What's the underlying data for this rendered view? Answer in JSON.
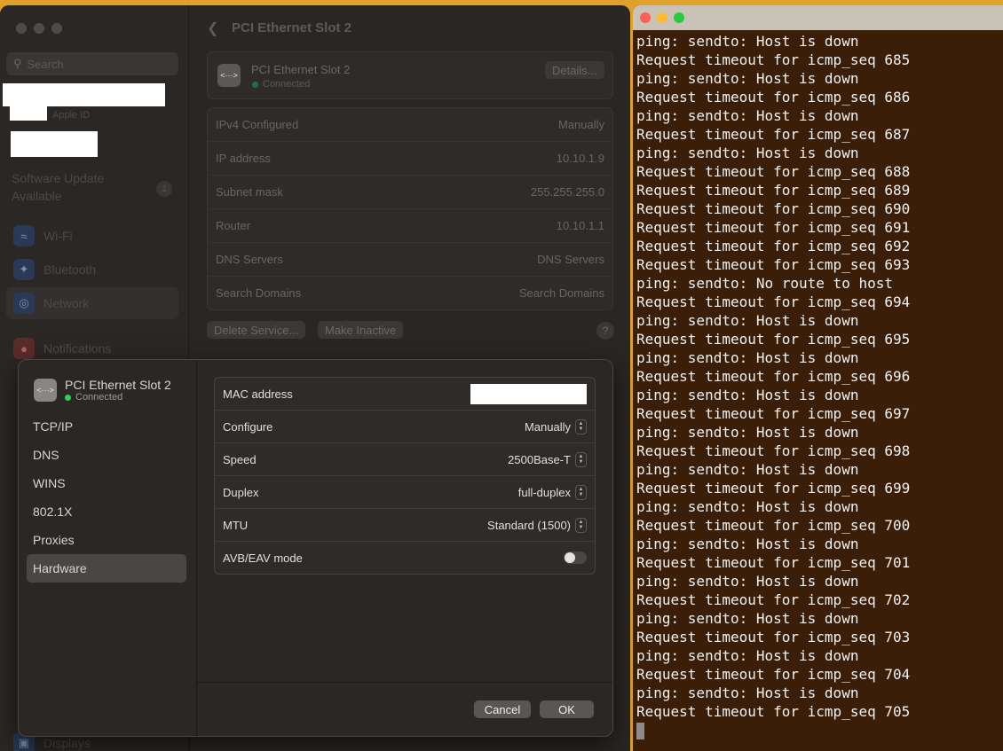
{
  "settings": {
    "search_placeholder": "Search",
    "apple_id_label": "Apple ID",
    "software_update_label": "Software Update Available",
    "software_update_badge": "1",
    "nav": [
      {
        "label": "Wi-Fi",
        "icon": "wifi-icon"
      },
      {
        "label": "Bluetooth",
        "icon": "bluetooth-icon"
      },
      {
        "label": "Network",
        "icon": "network-icon",
        "selected": true
      },
      {
        "label": "Notifications",
        "icon": "notifications-icon"
      },
      {
        "label": "Displays",
        "icon": "displays-icon"
      }
    ],
    "header_title": "PCI Ethernet Slot 2",
    "interface_name": "PCI Ethernet Slot 2",
    "interface_status": "Connected",
    "details_button": "Details...",
    "ipv4": {
      "configured_label": "IPv4 Configured",
      "configured_value": "Manually",
      "ip_label": "IP address",
      "ip_value": "10.10.1.9",
      "subnet_label": "Subnet mask",
      "subnet_value": "255.255.255.0",
      "router_label": "Router",
      "router_value": "10.10.1.1",
      "dns_label": "DNS Servers",
      "dns_value": "DNS Servers",
      "search_label": "Search Domains",
      "search_value": "Search Domains"
    },
    "delete_service_button": "Delete Service...",
    "make_inactive_button": "Make Inactive",
    "help_button": "?"
  },
  "sheet": {
    "interface_name": "PCI Ethernet Slot 2",
    "interface_status": "Connected",
    "tabs": [
      "TCP/IP",
      "DNS",
      "WINS",
      "802.1X",
      "Proxies",
      "Hardware"
    ],
    "selected_tab": "Hardware",
    "hardware": {
      "mac_label": "MAC address",
      "configure_label": "Configure",
      "configure_value": "Manually",
      "speed_label": "Speed",
      "speed_value": "2500Base-T",
      "duplex_label": "Duplex",
      "duplex_value": "full-duplex",
      "mtu_label": "MTU",
      "mtu_value": "Standard (1500)",
      "avb_label": "AVB/EAV mode",
      "avb_enabled": false
    },
    "cancel_button": "Cancel",
    "ok_button": "OK"
  },
  "terminal": {
    "lines": [
      "ping: sendto: Host is down",
      "Request timeout for icmp_seq 685",
      "ping: sendto: Host is down",
      "Request timeout for icmp_seq 686",
      "ping: sendto: Host is down",
      "Request timeout for icmp_seq 687",
      "ping: sendto: Host is down",
      "Request timeout for icmp_seq 688",
      "Request timeout for icmp_seq 689",
      "Request timeout for icmp_seq 690",
      "Request timeout for icmp_seq 691",
      "Request timeout for icmp_seq 692",
      "Request timeout for icmp_seq 693",
      "ping: sendto: No route to host",
      "Request timeout for icmp_seq 694",
      "ping: sendto: Host is down",
      "Request timeout for icmp_seq 695",
      "ping: sendto: Host is down",
      "Request timeout for icmp_seq 696",
      "ping: sendto: Host is down",
      "Request timeout for icmp_seq 697",
      "ping: sendto: Host is down",
      "Request timeout for icmp_seq 698",
      "ping: sendto: Host is down",
      "Request timeout for icmp_seq 699",
      "ping: sendto: Host is down",
      "Request timeout for icmp_seq 700",
      "ping: sendto: Host is down",
      "Request timeout for icmp_seq 701",
      "ping: sendto: Host is down",
      "Request timeout for icmp_seq 702",
      "ping: sendto: Host is down",
      "Request timeout for icmp_seq 703",
      "ping: sendto: Host is down",
      "Request timeout for icmp_seq 704",
      "ping: sendto: Host is down",
      "Request timeout for icmp_seq 705"
    ]
  }
}
